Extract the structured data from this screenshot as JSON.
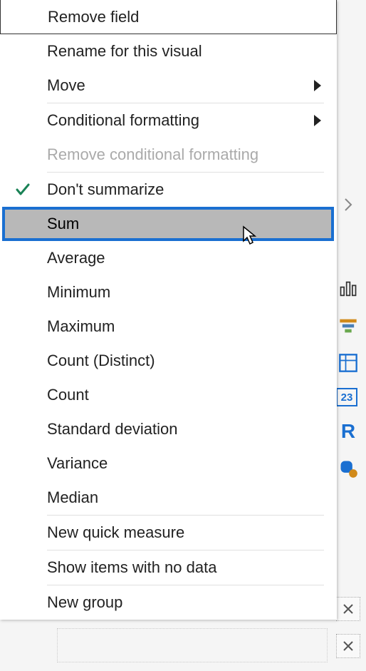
{
  "menu": {
    "remove_field": "Remove field",
    "rename_visual": "Rename for this visual",
    "move": "Move",
    "conditional_formatting": "Conditional formatting",
    "remove_conditional_formatting": "Remove conditional formatting",
    "dont_summarize": "Don't summarize",
    "sum": "Sum",
    "average": "Average",
    "minimum": "Minimum",
    "maximum": "Maximum",
    "count_distinct": "Count (Distinct)",
    "count": "Count",
    "standard_deviation": "Standard deviation",
    "variance": "Variance",
    "median": "Median",
    "new_quick_measure": "New quick measure",
    "show_items_no_data": "Show items with no data",
    "new_group": "New group"
  },
  "toolbar_icons": {
    "chevron": "expand",
    "chart": "chart",
    "funnel": "funnel",
    "matrix": "matrix",
    "calendar": "23",
    "r_visual": "R",
    "python": "py"
  }
}
